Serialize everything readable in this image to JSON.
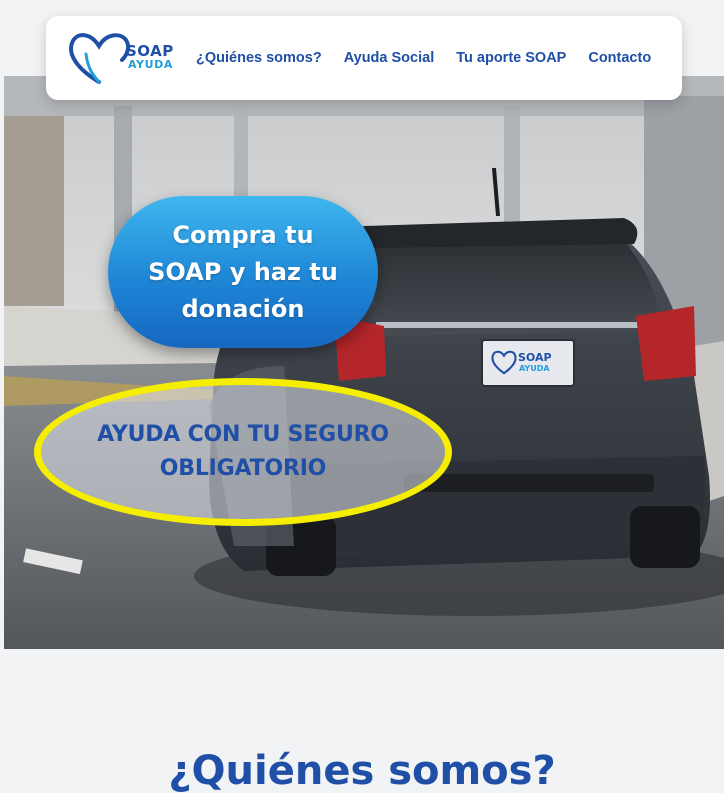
{
  "brand": {
    "logo_line1": "SOAP",
    "logo_line2": "AYUDA",
    "primary_color": "#1f4fa6",
    "accent_color": "#1fa0dc",
    "highlight_color": "#f6ee00"
  },
  "nav": {
    "items": [
      {
        "label": "¿Quiénes somos?"
      },
      {
        "label": "Ayuda Social"
      },
      {
        "label": "Tu aporte SOAP"
      },
      {
        "label": "Contacto"
      }
    ]
  },
  "hero": {
    "cta_text": "Compra tu SOAP y haz tu donación",
    "badge_text": "AYUDA CON TU SEGURO OBLIGATORIO",
    "plate_line1": "SOAP",
    "plate_line2": "AYUDA"
  },
  "section": {
    "title": "¿Quiénes somos?"
  }
}
